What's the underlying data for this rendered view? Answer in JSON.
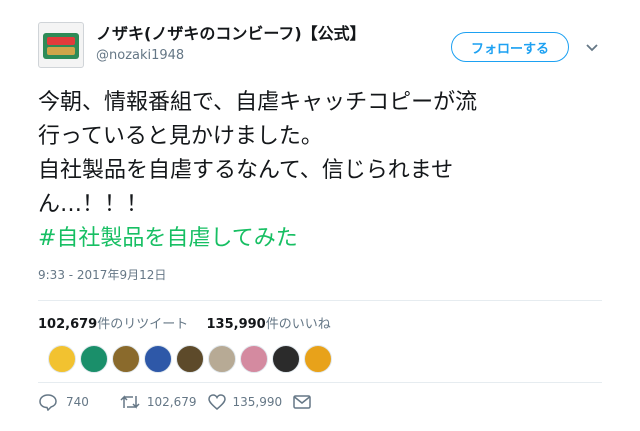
{
  "user": {
    "display_name": "ノザキ(ノザキのコンビーフ)【公式】",
    "handle": "@nozaki1948",
    "follow_label": "フォローする"
  },
  "tweet": {
    "lines": [
      "今朝、情報番組で、自虐キャッチコピーが流",
      "行っていると見かけました。",
      "自社製品を自虐するなんて、信じられませ",
      "ん…！！！"
    ],
    "hashtag": "#自社製品を自虐してみた",
    "timestamp": "9:33 - 2017年9月12日"
  },
  "stats": {
    "retweet_count": "102,679",
    "retweet_label": "件のリツイート",
    "like_count": "135,990",
    "like_label": "件のいいね"
  },
  "liker_avatars": [
    "#f2c230",
    "#1a8f6a",
    "#8a6a2c",
    "#2e58a8",
    "#5d4a2a",
    "#b7aa95",
    "#d48aa0",
    "#2b2b2b",
    "#e8a21a"
  ],
  "actions": {
    "reply_count": "740",
    "retweet_count": "102,679",
    "like_count": "135,990"
  },
  "colors": {
    "follow_accent": "#1da1f2",
    "hashtag": "#17bf63",
    "muted": "#657786"
  }
}
